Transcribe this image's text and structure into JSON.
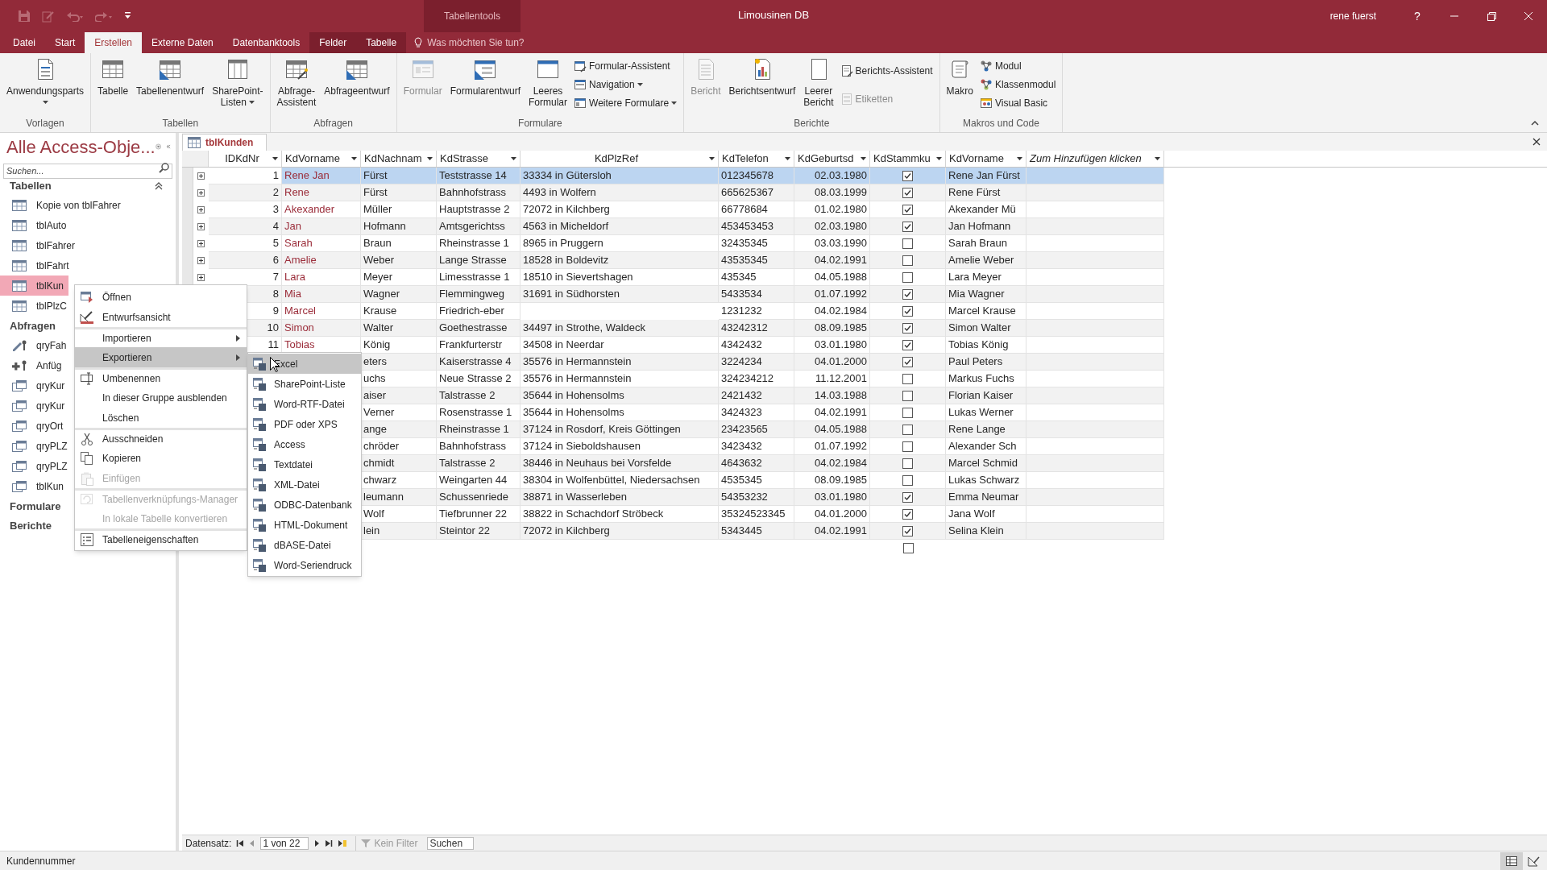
{
  "window": {
    "title": "Limousinen DB",
    "user": "rene fuerst",
    "help": "?",
    "contextual_group": "Tabellentools"
  },
  "ribbon": {
    "tabs": [
      {
        "label": "Datei",
        "selected": false,
        "contextual": false
      },
      {
        "label": "Start",
        "selected": false,
        "contextual": false
      },
      {
        "label": "Erstellen",
        "selected": true,
        "contextual": false
      },
      {
        "label": "Externe Daten",
        "selected": false,
        "contextual": false
      },
      {
        "label": "Datenbanktools",
        "selected": false,
        "contextual": false
      },
      {
        "label": "Felder",
        "selected": false,
        "contextual": true
      },
      {
        "label": "Tabelle",
        "selected": false,
        "contextual": true
      }
    ],
    "tell_me": {
      "placeholder": "Was möchten Sie tun?"
    },
    "groups": [
      {
        "label": "Vorlagen",
        "buttons": [
          {
            "kind": "parts",
            "label": "Anwendungsparts",
            "dropdown": true,
            "disabled": false
          }
        ]
      },
      {
        "label": "Tabellen",
        "buttons": [
          {
            "kind": "table",
            "label": "Tabelle",
            "dropdown": false,
            "disabled": false
          },
          {
            "kind": "table_design",
            "label": "Tabellenentwurf",
            "dropdown": false,
            "disabled": false
          },
          {
            "kind": "sharepoint",
            "label": "SharePoint-\nListen",
            "dropdown": true,
            "disabled": false
          }
        ]
      },
      {
        "label": "Abfragen",
        "buttons": [
          {
            "kind": "query_wizard",
            "label": "Abfrage-\nAssistent",
            "dropdown": false,
            "disabled": false
          },
          {
            "kind": "query_design",
            "label": "Abfrageentwurf",
            "dropdown": false,
            "disabled": false
          }
        ]
      },
      {
        "label": "Formulare",
        "buttons": [
          {
            "kind": "form",
            "label": "Formular",
            "dropdown": false,
            "disabled": true
          },
          {
            "kind": "form_design",
            "label": "Formularentwurf",
            "dropdown": false,
            "disabled": false
          },
          {
            "kind": "blank_form",
            "label": "Leeres\nFormular",
            "dropdown": false,
            "disabled": false
          },
          {
            "kind": "form_wizard",
            "label": "Formular-Assistent",
            "dropdown": false,
            "disabled": false
          },
          {
            "kind": "navigation",
            "label": "Navigation",
            "dropdown": true,
            "disabled": false
          },
          {
            "kind": "more_forms",
            "label": "Weitere Formulare",
            "dropdown": true,
            "disabled": false
          }
        ]
      },
      {
        "label": "Berichte",
        "buttons": [
          {
            "kind": "report",
            "label": "Bericht",
            "dropdown": false,
            "disabled": true
          },
          {
            "kind": "report_design",
            "label": "Berichtsentwurf",
            "dropdown": false,
            "disabled": false
          },
          {
            "kind": "blank_report",
            "label": "Leerer\nBericht",
            "dropdown": false,
            "disabled": false
          },
          {
            "kind": "report_wizard",
            "label": "Berichts-Assistent",
            "dropdown": false,
            "disabled": false
          },
          {
            "kind": "labels",
            "label": "Etiketten",
            "dropdown": false,
            "disabled": true
          }
        ]
      },
      {
        "label": "Makros und Code",
        "buttons": [
          {
            "kind": "macro",
            "label": "Makro",
            "dropdown": false,
            "disabled": false
          },
          {
            "kind": "module",
            "label": "Modul",
            "dropdown": false,
            "disabled": false
          },
          {
            "kind": "class_module",
            "label": "Klassenmodul",
            "dropdown": false,
            "disabled": false
          },
          {
            "kind": "visual_basic",
            "label": "Visual Basic",
            "dropdown": false,
            "disabled": false
          }
        ]
      }
    ]
  },
  "navigation_pane": {
    "title": "Alle Access-Obje...",
    "search": {
      "placeholder": "Suchen..."
    },
    "groups": [
      {
        "label": "Tabellen",
        "items": [
          {
            "label": "Kopie von tblFahrer",
            "kind": "table",
            "selected": false
          },
          {
            "label": "tblAuto",
            "kind": "table",
            "selected": false
          },
          {
            "label": "tblFahrer",
            "kind": "table",
            "selected": false
          },
          {
            "label": "tblFahrt",
            "kind": "table",
            "selected": false
          },
          {
            "label": "tblKun",
            "kind": "table",
            "selected": true
          },
          {
            "label": "tblPlzC",
            "kind": "table",
            "selected": false
          }
        ]
      },
      {
        "label": "Abfragen",
        "items": [
          {
            "label": "qryFah",
            "kind": "update_query",
            "selected": false
          },
          {
            "label": "Anfüg",
            "kind": "append_query",
            "selected": false
          },
          {
            "label": "qryKur",
            "kind": "select_query",
            "selected": false
          },
          {
            "label": "qryKur",
            "kind": "select_query",
            "selected": false
          },
          {
            "label": "qryOrt",
            "kind": "select_query",
            "selected": false
          },
          {
            "label": "qryPLZ",
            "kind": "select_query",
            "selected": false
          },
          {
            "label": "qryPLZ",
            "kind": "select_query",
            "selected": false
          },
          {
            "label": "tblKun",
            "kind": "select_query",
            "selected": false
          }
        ]
      },
      {
        "label": "Formulare"
      },
      {
        "label": "Berichte"
      }
    ]
  },
  "document_tabs": [
    {
      "label": "tblKunden",
      "selected": true
    }
  ],
  "table": {
    "columns": [
      {
        "label": "IDKdNr",
        "kind": "number"
      },
      {
        "label": "KdVorname",
        "kind": "link"
      },
      {
        "label": "KdNachnam",
        "kind": "text"
      },
      {
        "label": "KdStrasse",
        "kind": "text"
      },
      {
        "label": "KdPlzRef",
        "kind": "lookup"
      },
      {
        "label": "KdTelefon",
        "kind": "text"
      },
      {
        "label": "KdGeburtsd",
        "kind": "date"
      },
      {
        "label": "KdStammku",
        "kind": "check"
      },
      {
        "label": "KdVorname",
        "kind": "text"
      },
      {
        "label": "Zum Hinzufügen klicken",
        "kind": "add"
      }
    ],
    "rows": [
      {
        "expander": true,
        "selected": true,
        "cells": [
          "1",
          "Rene Jan",
          "Fürst",
          "Teststrasse 14",
          "33334 in Gütersloh",
          "012345678",
          "02.03.1980",
          true,
          "Rene Jan Fürst"
        ]
      },
      {
        "expander": true,
        "selected": false,
        "cells": [
          "2",
          "Rene",
          "Fürst",
          "Bahnhofstrass",
          "4493 in Wolfern",
          "665625367",
          "08.03.1999",
          true,
          "Rene Fürst"
        ]
      },
      {
        "expander": true,
        "selected": false,
        "cells": [
          "3",
          "Akexander",
          "Müller",
          "Hauptstrasse 2",
          "72072 in Kilchberg",
          "66778684",
          "01.02.1980",
          true,
          "Akexander Mü"
        ]
      },
      {
        "expander": true,
        "selected": false,
        "cells": [
          "4",
          "Jan",
          "Hofmann",
          "Amtsgerichtss",
          "4563 in Micheldorf",
          "453453453",
          "02.03.1980",
          true,
          "Jan Hofmann"
        ]
      },
      {
        "expander": true,
        "selected": false,
        "cells": [
          "5",
          "Sarah",
          "Braun",
          "Rheinstrasse 1",
          "8965 in Pruggern",
          "32435345",
          "03.03.1990",
          false,
          "Sarah Braun"
        ]
      },
      {
        "expander": true,
        "selected": false,
        "cells": [
          "6",
          "Amelie",
          "Weber",
          "Lange Strasse",
          "18528 in Boldevitz",
          "43535345",
          "04.02.1991",
          false,
          "Amelie Weber"
        ]
      },
      {
        "expander": true,
        "selected": false,
        "cells": [
          "7",
          "Lara",
          "Meyer",
          "Limesstrasse 1",
          "18510 in Sievertshagen",
          "435345",
          "04.05.1988",
          false,
          "Lara Meyer"
        ]
      },
      {
        "selected": false,
        "cells": [
          "8",
          "Mia",
          "Wagner",
          "Flemmingweg",
          "31691 in Südhorsten",
          "5433534",
          "01.07.1992",
          true,
          "Mia Wagner"
        ]
      },
      {
        "selected": false,
        "cells": [
          "9",
          "Marcel",
          "Krause",
          "Friedrich-eber",
          null,
          "1231232",
          "04.02.1984",
          true,
          "Marcel Krause"
        ]
      },
      {
        "selected": false,
        "cells": [
          "10",
          "Simon",
          "Walter",
          "Goethestrasse",
          "34497 in Strothe, Waldeck",
          "43242312",
          "08.09.1985",
          true,
          "Simon Walter"
        ]
      },
      {
        "selected": false,
        "cells": [
          "11",
          "Tobias",
          "König",
          "Frankfurterstr",
          "34508 in Neerdar",
          "4342432",
          "03.01.1980",
          true,
          "Tobias König"
        ]
      },
      {
        "selected": false,
        "cells": [
          null,
          null,
          "eters",
          "Kaiserstrasse 4",
          "35576 in Hermannstein",
          "3224234",
          "04.01.2000",
          true,
          "Paul Peters"
        ]
      },
      {
        "selected": false,
        "cells": [
          null,
          null,
          "uchs",
          "Neue Strasse 2",
          "35576 in Hermannstein",
          "324234212",
          "11.12.2001",
          false,
          "Markus Fuchs"
        ]
      },
      {
        "selected": false,
        "cells": [
          null,
          null,
          "aiser",
          "Talstrasse 2",
          "35644 in Hohensolms",
          "2421432",
          "14.03.1988",
          false,
          "Florian Kaiser"
        ]
      },
      {
        "selected": false,
        "cells": [
          null,
          null,
          "Verner",
          "Rosenstrasse 1",
          "35644 in Hohensolms",
          "3424323",
          "04.02.1991",
          false,
          "Lukas Werner"
        ]
      },
      {
        "selected": false,
        "cells": [
          null,
          null,
          "ange",
          "Rheinstrasse 1",
          "37124 in Rosdorf, Kreis Göttingen",
          "23423565",
          "04.05.1988",
          false,
          "Rene Lange"
        ]
      },
      {
        "selected": false,
        "cells": [
          null,
          null,
          "chröder",
          "Bahnhofstrass",
          "37124 in Sieboldshausen",
          "3423432",
          "01.07.1992",
          false,
          "Alexander Sch"
        ]
      },
      {
        "selected": false,
        "cells": [
          null,
          null,
          "chmidt",
          "Talstrasse 2",
          "38446 in Neuhaus bei Vorsfelde",
          "4643632",
          "04.02.1984",
          false,
          "Marcel Schmid"
        ]
      },
      {
        "selected": false,
        "cells": [
          null,
          null,
          "chwarz",
          "Weingarten 44",
          "38304 in Wolfenbüttel, Niedersachsen",
          "4535345",
          "08.09.1985",
          false,
          "Lukas Schwarz"
        ]
      },
      {
        "selected": false,
        "cells": [
          null,
          null,
          "leumann",
          "Schussenriede",
          "38871 in Wasserleben",
          "54353232",
          "03.01.1980",
          true,
          "Emma Neumar"
        ]
      },
      {
        "selected": false,
        "cells": [
          null,
          null,
          "Wolf",
          "Tiefbrunner 22",
          "38822 in Schachdorf Ströbeck",
          "35324523345",
          "04.01.2000",
          true,
          "Jana Wolf"
        ]
      },
      {
        "selected": false,
        "cells": [
          null,
          null,
          "lein",
          "Steintor 22",
          "72072 in Kilchberg",
          "5343445",
          "04.02.1991",
          true,
          "Selina Klein"
        ]
      }
    ],
    "new_row": {
      "stammkunde": false
    }
  },
  "context_menu": {
    "items": [
      {
        "label": "Öffnen",
        "kind": "open",
        "submenu": false,
        "selected": false,
        "disabled": false,
        "separator_before": false
      },
      {
        "label": "Entwurfsansicht",
        "kind": "design",
        "submenu": false,
        "selected": false,
        "disabled": false,
        "separator_before": false
      },
      {
        "label": "Importieren",
        "kind": "plain",
        "submenu": true,
        "selected": false,
        "disabled": false,
        "separator_before": true
      },
      {
        "label": "Exportieren",
        "kind": "plain",
        "submenu": true,
        "selected": true,
        "disabled": false,
        "separator_before": false
      },
      {
        "label": "Umbenennen",
        "kind": "rename",
        "submenu": false,
        "selected": false,
        "disabled": false,
        "separator_before": true
      },
      {
        "label": "In dieser Gruppe ausblenden",
        "kind": "plain",
        "submenu": false,
        "selected": false,
        "disabled": false,
        "separator_before": false
      },
      {
        "label": "Löschen",
        "kind": "plain",
        "submenu": false,
        "selected": false,
        "disabled": false,
        "separator_before": false
      },
      {
        "label": "Ausschneiden",
        "kind": "cut",
        "submenu": false,
        "selected": false,
        "disabled": false,
        "separator_before": true
      },
      {
        "label": "Kopieren",
        "kind": "copy",
        "submenu": false,
        "selected": false,
        "disabled": false,
        "separator_before": false
      },
      {
        "label": "Einfügen",
        "kind": "paste",
        "submenu": false,
        "selected": false,
        "disabled": true,
        "separator_before": false
      },
      {
        "label": "Tabellenverknüpfungs-Manager",
        "kind": "link_manager",
        "submenu": false,
        "selected": false,
        "disabled": true,
        "separator_before": true
      },
      {
        "label": "In lokale Tabelle konvertieren",
        "kind": "plain",
        "submenu": false,
        "selected": false,
        "disabled": true,
        "separator_before": false
      },
      {
        "label": "Tabelleneigenschaften",
        "kind": "properties",
        "submenu": false,
        "selected": false,
        "disabled": false,
        "separator_before": true
      }
    ],
    "submenu": [
      {
        "label": "Excel",
        "selected": true
      },
      {
        "label": "SharePoint-Liste",
        "selected": false
      },
      {
        "label": "Word-RTF-Datei",
        "selected": false
      },
      {
        "label": "PDF oder XPS",
        "selected": false
      },
      {
        "label": "Access",
        "selected": false
      },
      {
        "label": "Textdatei",
        "selected": false
      },
      {
        "label": "XML-Datei",
        "selected": false
      },
      {
        "label": "ODBC-Datenbank",
        "selected": false
      },
      {
        "label": "HTML-Dokument",
        "selected": false
      },
      {
        "label": "dBASE-Datei",
        "selected": false
      },
      {
        "label": "Word-Seriendruck",
        "selected": false
      }
    ]
  },
  "record_navigator": {
    "label": "Datensatz:",
    "position": "1 von 22",
    "filter": "Kein Filter",
    "search": {
      "placeholder": "Suchen"
    }
  },
  "status_bar": {
    "text": "Kundennummer"
  }
}
